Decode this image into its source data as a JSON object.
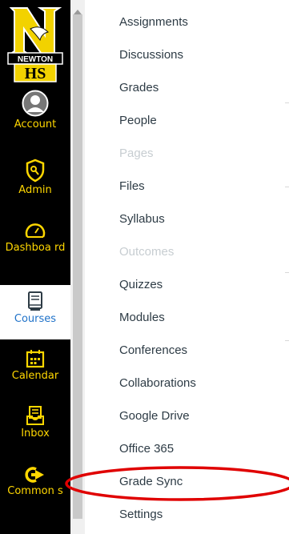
{
  "global_nav": {
    "logo": {
      "letter": "N",
      "word": "NEWTON",
      "initials": "HS"
    },
    "items": [
      {
        "label": "Account",
        "icon": "account-avatar-icon"
      },
      {
        "label": "Admin",
        "icon": "admin-shield-icon"
      },
      {
        "label": "Dashboa rd",
        "icon": "dashboard-gauge-icon"
      },
      {
        "label": "Courses",
        "icon": "courses-book-icon",
        "active": true
      },
      {
        "label": "Calendar",
        "icon": "calendar-icon"
      },
      {
        "label": "Inbox",
        "icon": "inbox-icon"
      },
      {
        "label": "Common s",
        "icon": "commons-arrow-icon"
      }
    ],
    "colors": {
      "background": "#000000",
      "text": "#ffd700",
      "active_text": "#1f72c9"
    }
  },
  "course_menu": {
    "items": [
      {
        "label": "Assignments"
      },
      {
        "label": "Discussions"
      },
      {
        "label": "Grades"
      },
      {
        "label": "People"
      },
      {
        "label": "Pages",
        "disabled": true
      },
      {
        "label": "Files"
      },
      {
        "label": "Syllabus"
      },
      {
        "label": "Outcomes",
        "disabled": true
      },
      {
        "label": "Quizzes"
      },
      {
        "label": "Modules"
      },
      {
        "label": "Conferences"
      },
      {
        "label": "Collaborations"
      },
      {
        "label": "Google Drive"
      },
      {
        "label": "Office 365"
      },
      {
        "label": "Grade Sync"
      },
      {
        "label": "Settings"
      }
    ]
  },
  "annotation": {
    "target": "Grade Sync",
    "color": "#e00000"
  }
}
